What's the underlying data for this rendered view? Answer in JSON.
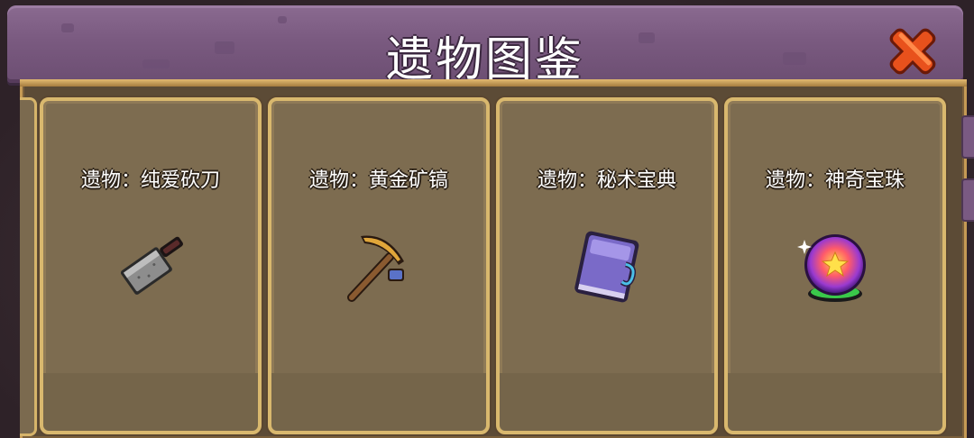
{
  "window": {
    "title": "遗物图鉴"
  },
  "close_button": {
    "icon": "close-x-icon",
    "color": "#e8511c"
  },
  "relics": [
    {
      "name": "遗物：纯爱砍刀",
      "icon": "cleaver-icon"
    },
    {
      "name": "遗物：黄金矿镐",
      "icon": "pickaxe-icon"
    },
    {
      "name": "遗物：秘术宝典",
      "icon": "spellbook-icon"
    },
    {
      "name": "遗物：神奇宝珠",
      "icon": "orb-icon"
    }
  ],
  "colors": {
    "header": "#7a5a80",
    "panel": "#5c4b36",
    "card": "#7d6c50",
    "card_border": "#d9b86e"
  }
}
